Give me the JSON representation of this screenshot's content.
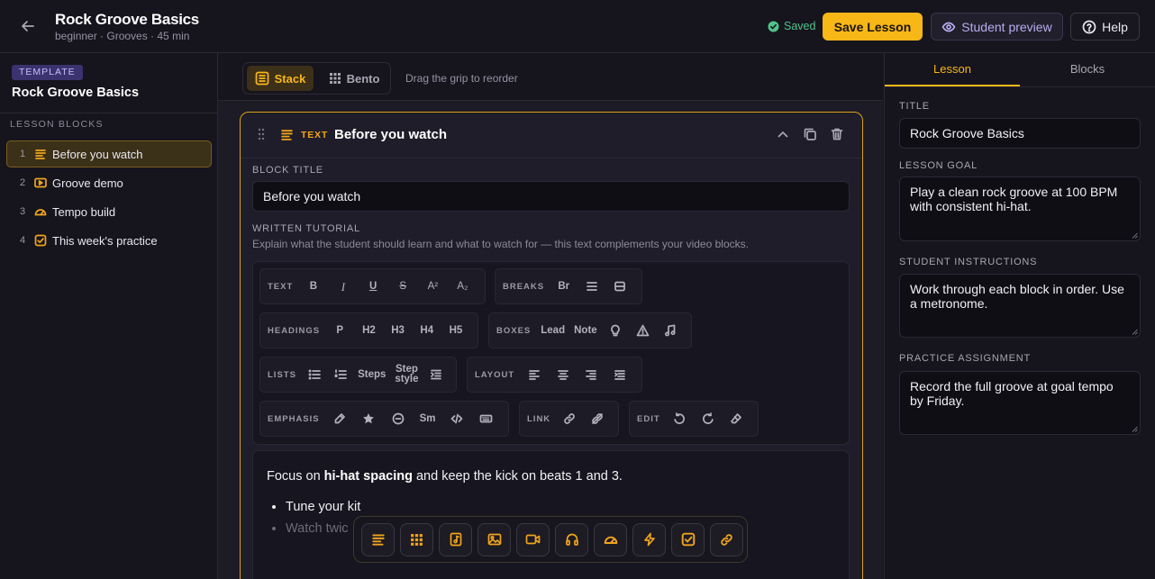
{
  "header": {
    "title": "Rock Groove Basics",
    "meta": "beginner · Grooves · 45 min",
    "saved_label": "Saved",
    "save_button": "Save Lesson",
    "preview_button": "Student preview",
    "help_button": "Help"
  },
  "sidebar": {
    "badge": "TEMPLATE",
    "lesson_title": "Rock Groove Basics",
    "section_heading": "LESSON BLOCKS",
    "items": [
      {
        "num": "1",
        "label": "Before you watch",
        "icon": "text-lines-icon",
        "active": true
      },
      {
        "num": "2",
        "label": "Groove demo",
        "icon": "video-play-icon",
        "active": false
      },
      {
        "num": "3",
        "label": "Tempo build",
        "icon": "gauge-icon",
        "active": false
      },
      {
        "num": "4",
        "label": "This week's practice",
        "icon": "checkbox-icon",
        "active": false
      }
    ]
  },
  "view": {
    "stack_label": "Stack",
    "bento_label": "Bento",
    "hint": "Drag the grip to reorder"
  },
  "block": {
    "type_label": "TEXT",
    "title": "Before you watch",
    "title_field_label": "BLOCK TITLE",
    "title_value": "Before you watch",
    "tutorial_label": "WRITTEN TUTORIAL",
    "tutorial_hint": "Explain what the student should learn and what to watch for — this text complements your video blocks."
  },
  "toolbar": {
    "text": {
      "label": "TEXT",
      "buttons": [
        "B",
        "I",
        "U",
        "S",
        "A²",
        "A₂"
      ]
    },
    "breaks": {
      "label": "BREAKS",
      "br": "Br"
    },
    "headings": {
      "label": "HEADINGS",
      "buttons": [
        "P",
        "H2",
        "H3",
        "H4",
        "H5"
      ]
    },
    "boxes": {
      "label": "BOXES",
      "lead": "Lead",
      "note": "Note"
    },
    "lists": {
      "label": "LISTS",
      "steps": "Steps",
      "step_style": "Step style"
    },
    "layout": {
      "label": "LAYOUT"
    },
    "emphasis": {
      "label": "EMPHASIS",
      "sm": "Sm"
    },
    "link": {
      "label": "LINK"
    },
    "edit": {
      "label": "EDIT"
    }
  },
  "editor": {
    "para_before": "Focus on ",
    "para_bold": "hi-hat spacing",
    "para_after": " and keep the kick on beats 1 and 3.",
    "list": [
      "Tune your kit",
      "Watch twic"
    ]
  },
  "right_panel": {
    "tabs": [
      "Lesson",
      "Blocks"
    ],
    "title_label": "TITLE",
    "title_value": "Rock Groove Basics",
    "goal_label": "LESSON GOAL",
    "goal_value": "Play a clean rock groove at 100 BPM with consistent hi-hat.",
    "instructions_label": "STUDENT INSTRUCTIONS",
    "instructions_value": "Work through each block in order. Use a metronome.",
    "assignment_label": "PRACTICE ASSIGNMENT",
    "assignment_value": "Record the full groove at goal tempo by Friday."
  },
  "colors": {
    "accent": "#f7b716",
    "saved": "#4fc48a",
    "background": "#16141d"
  }
}
